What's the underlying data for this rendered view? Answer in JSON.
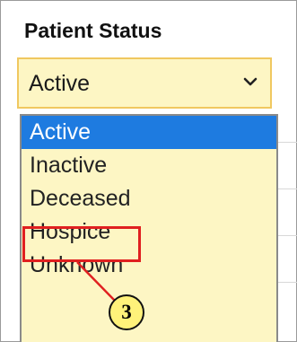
{
  "section": {
    "title": "Patient Status"
  },
  "select": {
    "value": "Active",
    "options": [
      {
        "label": "Active",
        "selected": true
      },
      {
        "label": "Inactive",
        "selected": false
      },
      {
        "label": "Deceased",
        "selected": false
      },
      {
        "label": "Hospice",
        "selected": false
      },
      {
        "label": "Unknown",
        "selected": false
      }
    ]
  },
  "annotation": {
    "step": "3",
    "highlighted_option": "Hospice",
    "color": "#e02020",
    "badge_color": "#fff27a"
  },
  "colors": {
    "highlight": "#1e7be0",
    "field_bg": "#fdf6c4",
    "field_border": "#f0c860"
  }
}
